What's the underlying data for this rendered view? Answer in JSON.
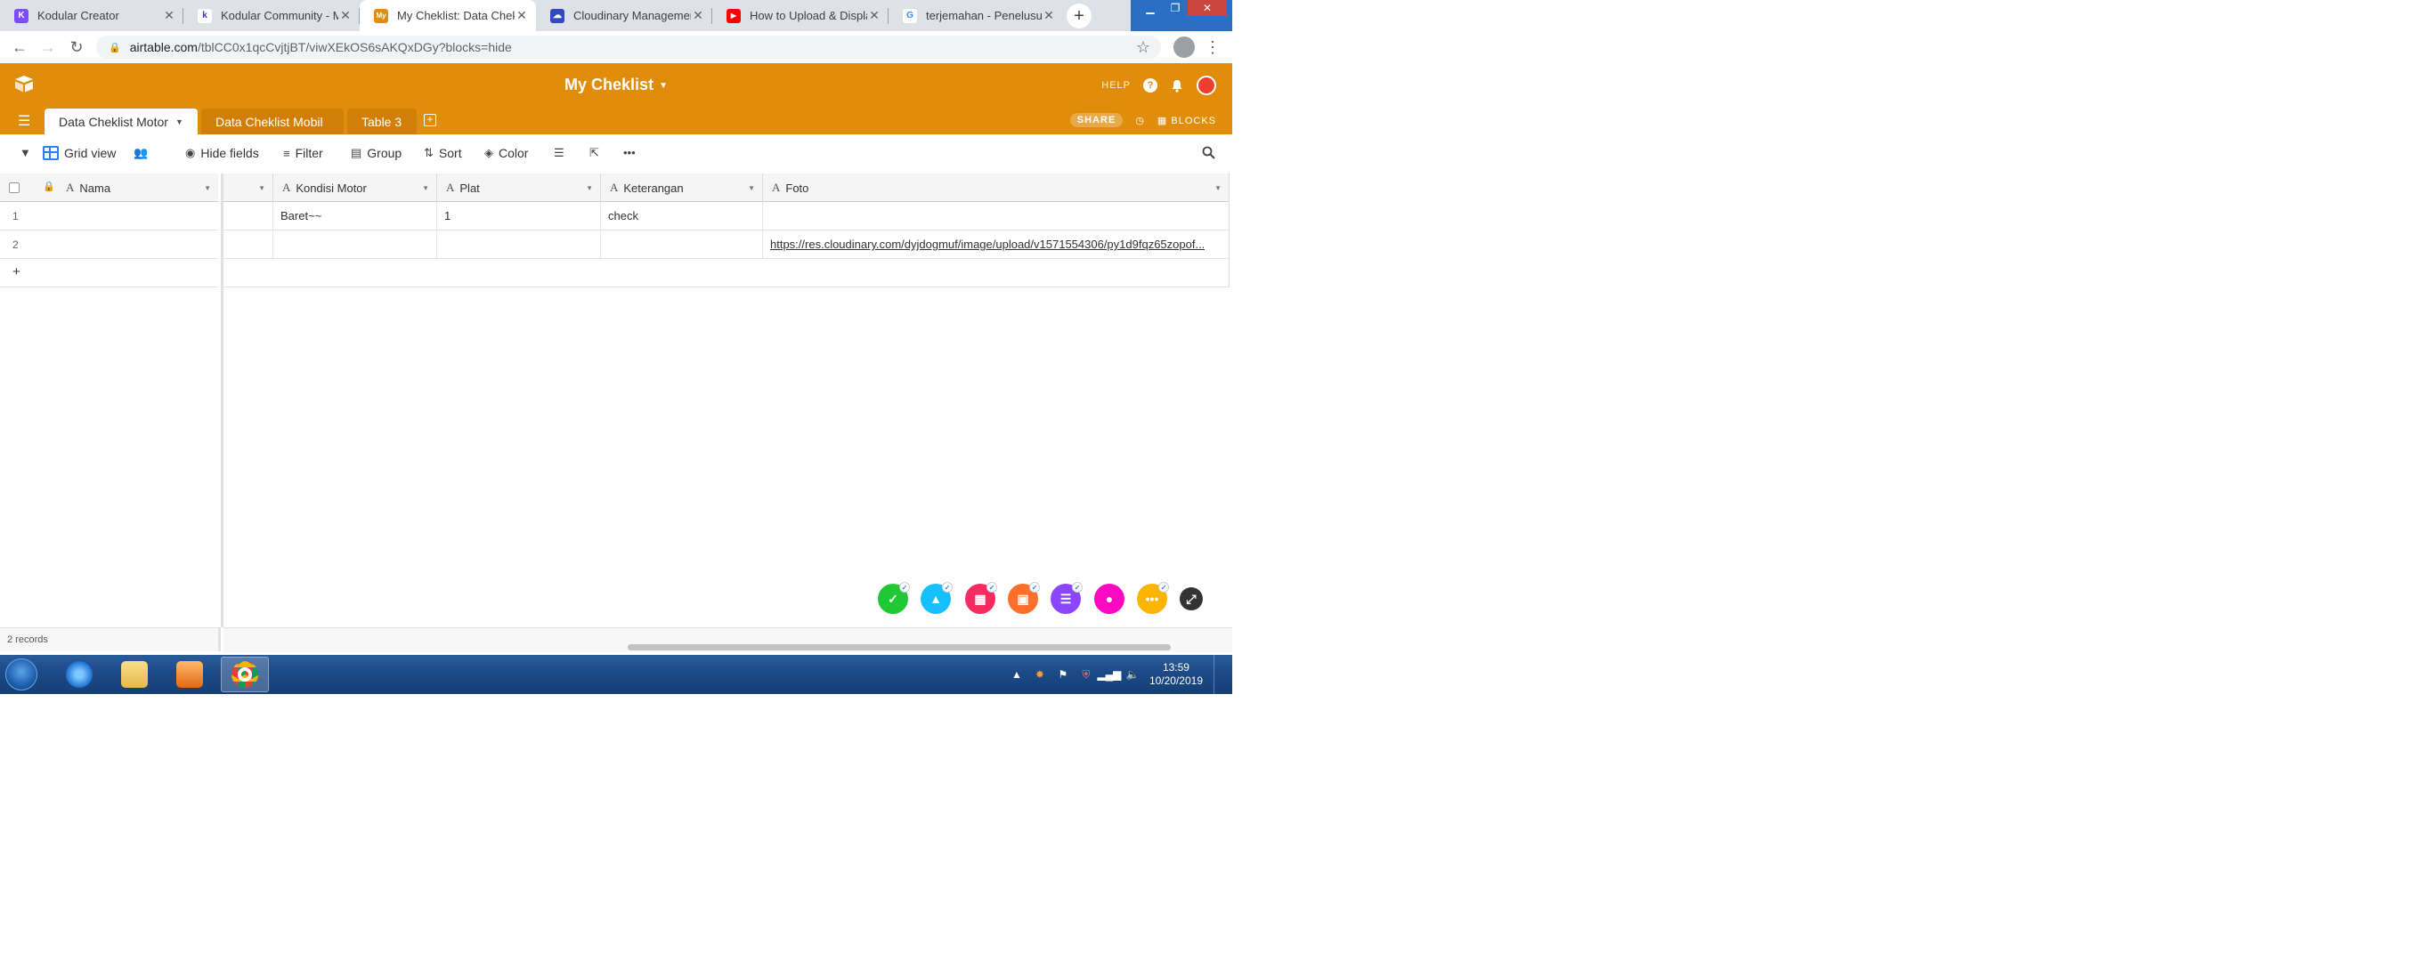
{
  "browser": {
    "tabs": [
      {
        "title": "Kodular Creator",
        "favicon_color": "#7c4dff",
        "favicon_glyph": "K"
      },
      {
        "title": "Kodular Community - Mi",
        "favicon_color": "#ffffff",
        "favicon_glyph": "k"
      },
      {
        "title": "My Cheklist: Data Cheklis",
        "favicon_color": "#e08d0b",
        "favicon_glyph": "My"
      },
      {
        "title": "Cloudinary Management",
        "favicon_color": "#3448c5",
        "favicon_glyph": "☁"
      },
      {
        "title": "How to Upload & Displa",
        "favicon_color": "#ff0000",
        "favicon_glyph": "▶"
      },
      {
        "title": "terjemahan - Penelusura",
        "favicon_color": "#ffffff",
        "favicon_glyph": "G"
      }
    ],
    "active_tab": 2,
    "url_host": "airtable.com",
    "url_path": "/tblCC0x1qcCvjtjBT/viwXEkOS6sAKQxDGy?blocks=hide"
  },
  "airtable": {
    "base_title": "My Cheklist",
    "help_label": "HELP",
    "tables": [
      "Data Cheklist Motor",
      "Data Cheklist Mobil",
      "Table 3"
    ],
    "share_label": "SHARE",
    "blocks_label": "BLOCKS",
    "brand_color": "#e08d0b"
  },
  "toolbar": {
    "view_name": "Grid view",
    "hide_fields": "Hide fields",
    "filter": "Filter",
    "group": "Group",
    "sort": "Sort",
    "color": "Color"
  },
  "grid": {
    "primary_field": "Nama",
    "columns": [
      "Kondisi Motor",
      "Plat",
      "Keterangan",
      "Foto"
    ],
    "rows": [
      {
        "num": "1",
        "kondisi": "Baret~~",
        "plat": "1",
        "keterangan": "check",
        "foto": ""
      },
      {
        "num": "2",
        "kondisi": "",
        "plat": "",
        "keterangan": "",
        "foto": "https://res.cloudinary.com/dyjdogmuf/image/upload/v1571554306/py1d9fqz65zopof..."
      }
    ],
    "add_row": "+",
    "record_count": "2 records"
  },
  "fab_colors": [
    "#20c933",
    "#18bfff",
    "#f82b60",
    "#ff6f2c",
    "#8b46ff",
    "#ff08c2",
    "#fcb400",
    "#333333"
  ],
  "taskbar": {
    "time": "13:59",
    "date": "10/20/2019"
  }
}
